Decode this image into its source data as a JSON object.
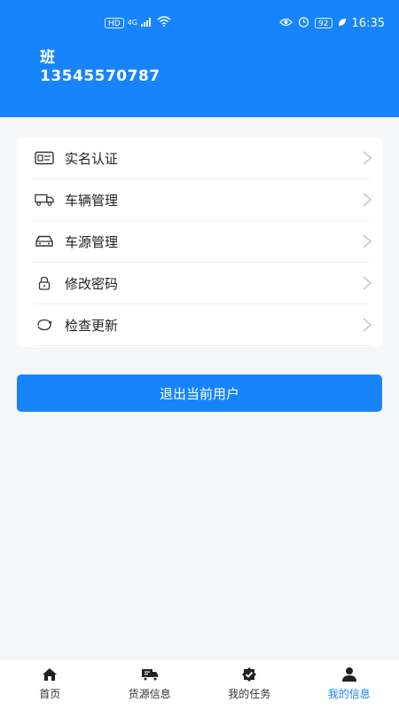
{
  "status_bar": {
    "left_indicators": [
      "HD",
      "4G"
    ],
    "battery": "92",
    "time": "16:35"
  },
  "user": {
    "name": "班",
    "phone": "13545570787"
  },
  "menu": {
    "items": [
      {
        "label": "实名认证",
        "icon": "id-card-icon"
      },
      {
        "label": "车辆管理",
        "icon": "truck-icon"
      },
      {
        "label": "车源管理",
        "icon": "car-icon"
      },
      {
        "label": "修改密码",
        "icon": "lock-icon"
      },
      {
        "label": "检查更新",
        "icon": "refresh-icon"
      }
    ]
  },
  "logout_label": "退出当前用户",
  "nav": {
    "items": [
      {
        "label": "首页",
        "icon": "home-icon",
        "active": false
      },
      {
        "label": "货源信息",
        "icon": "cargo-truck-icon",
        "active": false
      },
      {
        "label": "我的任务",
        "icon": "task-check-icon",
        "active": false
      },
      {
        "label": "我的信息",
        "icon": "user-icon",
        "active": true
      }
    ]
  },
  "colors": {
    "primary": "#1784fb",
    "background": "#f5f6f8",
    "text": "#222222",
    "chevron": "#c9cbd0"
  }
}
